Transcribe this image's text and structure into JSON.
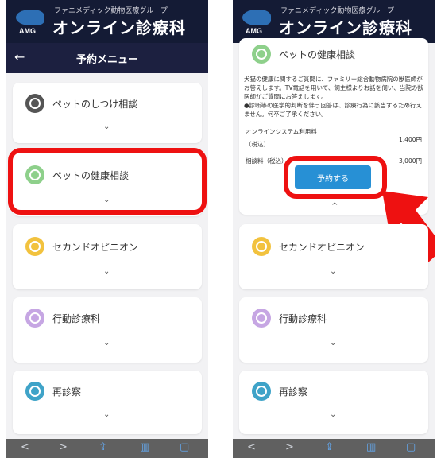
{
  "header": {
    "group_name": "ファニメディック動物医療グループ",
    "title": "オンライン診療科",
    "logo_text": "AMG"
  },
  "nav": {
    "back_icon": "←",
    "title": "予約メニュー"
  },
  "menu": [
    {
      "label": "ペットのしつけ相談",
      "color": "#555555",
      "icon": "dog-icon"
    },
    {
      "label": "ペットの健康相談",
      "color": "#8ed08b",
      "icon": "health-icon"
    },
    {
      "label": "セカンドオピニオン",
      "color": "#f2c23e",
      "icon": "second-opinion-icon"
    },
    {
      "label": "行動診療科",
      "color": "#c6a6e3",
      "icon": "behavior-icon"
    },
    {
      "label": "再診察",
      "color": "#3fa3c8",
      "icon": "revisit-icon"
    }
  ],
  "chevron": "⌄",
  "chevron_up": "^",
  "expanded": {
    "title": "ペットの健康相談",
    "description": "犬猫の健康に関するご質問に、ファミリー総合動物病院の獣医師がお答えします。TV電話を用いて、飼主様よりお話を伺い、当院の獣医師がご質問にお答えします。\n●診断等の医学的判断を伴う回答は、診療行為に該当するため行えません。何卒ご了承ください。",
    "fee1_label": "オンラインシステム利用料",
    "fee1_sub": "（税込）",
    "fee1_value": "1,400円",
    "fee2_label": "相談料（税込）",
    "fee2_value": "3,000円",
    "reserve_button": "予約する"
  },
  "bottom_bar": [
    "<",
    ">",
    "share-icon",
    "book-icon",
    "tabs-icon"
  ],
  "colors": {
    "brand_dark": "#141b35",
    "highlight_red": "#ee1111",
    "button_blue": "#2790d5"
  }
}
